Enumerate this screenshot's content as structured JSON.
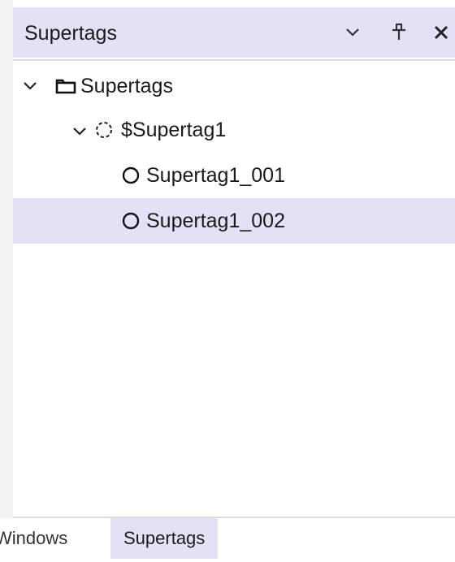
{
  "panel": {
    "title": "Supertags",
    "buttons": [
      {
        "name": "dropdown",
        "icon": "chevron-down-icon"
      },
      {
        "name": "pin",
        "icon": "pin-icon"
      },
      {
        "name": "close",
        "icon": "close-icon"
      }
    ]
  },
  "tree": {
    "root": {
      "label": "Supertags",
      "icon": "folder-icon",
      "expanded": true
    },
    "template": {
      "label": "$Supertag1",
      "icon": "dashed-circle-icon",
      "expanded": true
    },
    "instances": [
      {
        "label": "Supertag1_001",
        "icon": "circle-icon",
        "selected": false
      },
      {
        "label": "Supertag1_002",
        "icon": "circle-icon",
        "selected": true
      }
    ]
  },
  "tabs": [
    {
      "label": "Windows",
      "active": false
    },
    {
      "label": "Supertags",
      "active": true
    }
  ],
  "colors": {
    "header_bg": "#e2e2f6",
    "selection_bg": "#e2e2f6",
    "divider": "#dcdcdc",
    "text": "#1a1a1a"
  }
}
